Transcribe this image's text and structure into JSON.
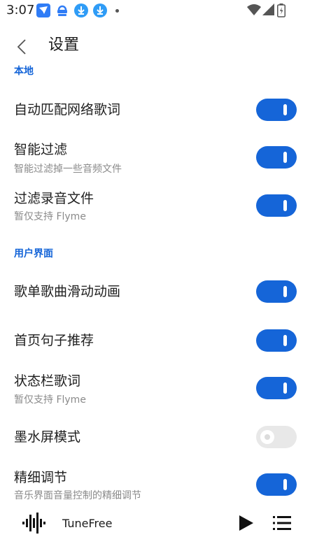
{
  "status_bar": {
    "time": "3:07",
    "icons": [
      "feishu-icon",
      "download-badge-icon",
      "download-icon",
      "download-icon",
      "notification-dot"
    ],
    "right_icons": [
      "wifi-icon",
      "signal-icon",
      "battery-icon"
    ]
  },
  "app_bar": {
    "title": "设置"
  },
  "sections": {
    "local": {
      "header": "本地"
    },
    "ui": {
      "header": "用户界面"
    }
  },
  "settings": {
    "auto_match_lyrics": {
      "title": "自动匹配网络歌词",
      "enabled": true
    },
    "smart_filter": {
      "title": "智能过滤",
      "subtitle": "智能过滤掉一些音频文件",
      "enabled": true
    },
    "filter_recordings": {
      "title": "过滤录音文件",
      "subtitle": "暂仅支持 Flyme",
      "enabled": true
    },
    "playlist_animation": {
      "title": "歌单歌曲滑动动画",
      "enabled": true
    },
    "home_quote": {
      "title": "首页句子推荐",
      "enabled": true
    },
    "statusbar_lyrics": {
      "title": "状态栏歌词",
      "subtitle": "暂仅支持 Flyme",
      "enabled": true
    },
    "eink_mode": {
      "title": "墨水屏模式",
      "enabled": false
    },
    "fine_tuning": {
      "title": "精细调节",
      "subtitle": "音乐界面音量控制的精细调节",
      "enabled": true
    }
  },
  "player": {
    "title": "TuneFree"
  },
  "colors": {
    "accent": "#1565d8",
    "toggle_off": "#e8e8e8",
    "subtitle": "#8a8a8a"
  }
}
